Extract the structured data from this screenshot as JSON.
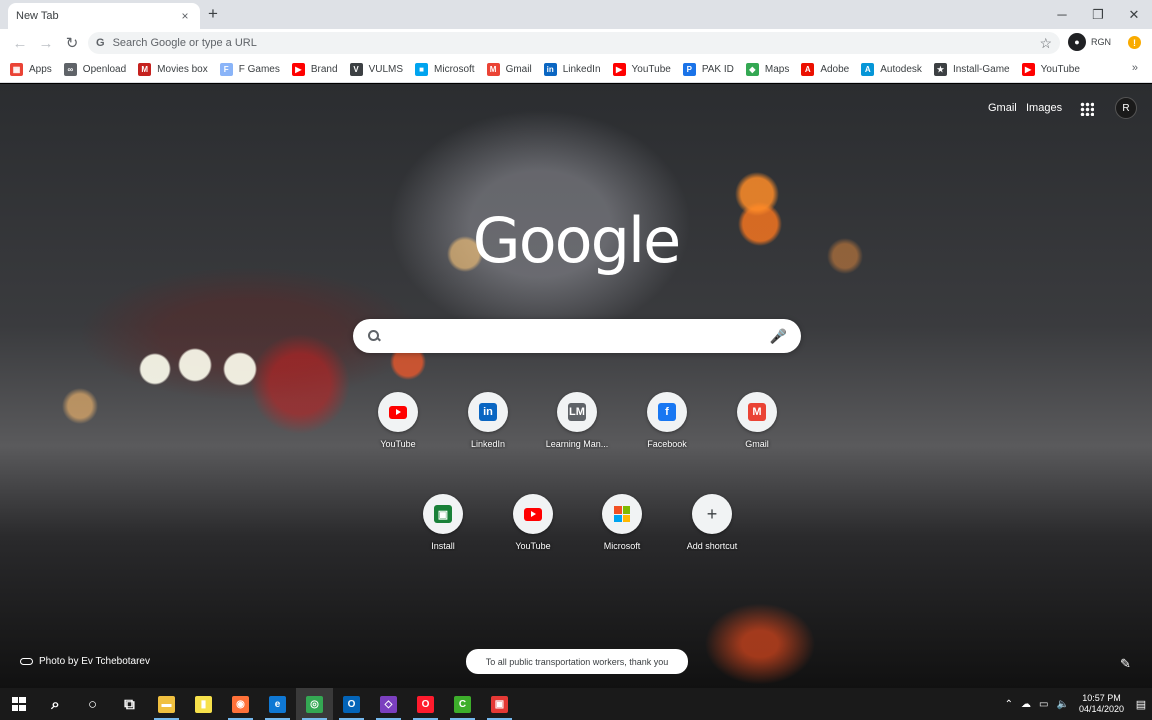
{
  "browser": {
    "tab_title": "New Tab",
    "tab_close": "×",
    "new_tab": "+",
    "window_controls": {
      "minimize": "─",
      "restore": "❐",
      "close": "✕"
    },
    "nav": {
      "back": "←",
      "forward": "→",
      "reload": "↻"
    },
    "omnibox_g": "G",
    "omnibox_placeholder": "Search Google or type a URL",
    "star": "☆",
    "profile_initial": "●",
    "profile_name": "RGN",
    "update_badge": "!"
  },
  "bookmarks": [
    {
      "label": "Apps",
      "color": "#ea4335",
      "glyph": "▦"
    },
    {
      "label": "Openload",
      "color": "#5f6368",
      "glyph": "∞"
    },
    {
      "label": "Movies box",
      "color": "#c5221f",
      "glyph": "M"
    },
    {
      "label": "F Games",
      "color": "#8ab4f8",
      "glyph": "F"
    },
    {
      "label": "Brand",
      "color": "#ff0000",
      "glyph": "▶"
    },
    {
      "label": "VULMS",
      "color": "#3c4043",
      "glyph": "V"
    },
    {
      "label": "Microsoft",
      "color": "#00a4ef",
      "glyph": "■"
    },
    {
      "label": "Gmail",
      "color": "#ea4335",
      "glyph": "M"
    },
    {
      "label": "LinkedIn",
      "color": "#0a66c2",
      "glyph": "in"
    },
    {
      "label": "YouTube",
      "color": "#ff0000",
      "glyph": "▶"
    },
    {
      "label": "PAK ID",
      "color": "#1a73e8",
      "glyph": "P"
    },
    {
      "label": "Maps",
      "color": "#34a853",
      "glyph": "◆"
    },
    {
      "label": "Adobe",
      "color": "#eb1000",
      "glyph": "A"
    },
    {
      "label": "Autodesk",
      "color": "#0696d7",
      "glyph": "A"
    },
    {
      "label": "Install-Game",
      "color": "#3c4043",
      "glyph": "★"
    },
    {
      "label": "YouTube",
      "color": "#ff0000",
      "glyph": "▶"
    }
  ],
  "bookmarks_more": "»",
  "ntp": {
    "gmail_link": "Gmail",
    "images_link": "Images",
    "account_initial": "R",
    "logo": "Google",
    "mic": "🎤",
    "photo_credit": "Photo by Ev Tchebotarev",
    "promo": "To all public transportation workers, thank you",
    "edit": "✎"
  },
  "shortcuts": [
    {
      "label": "YouTube",
      "type": "yt"
    },
    {
      "label": "LinkedIn",
      "type": "box",
      "glyph": "in",
      "color": "#0a66c2"
    },
    {
      "label": "Learning Man...",
      "type": "box",
      "glyph": "LM",
      "color": "#5f6368"
    },
    {
      "label": "Facebook",
      "type": "box",
      "glyph": "f",
      "color": "#1877f2"
    },
    {
      "label": "Gmail",
      "type": "box",
      "glyph": "M",
      "color": "#ea4335"
    },
    {
      "label": "Install",
      "type": "box",
      "glyph": "▣",
      "color": "#188038"
    },
    {
      "label": "YouTube",
      "type": "yt"
    },
    {
      "label": "Microsoft",
      "type": "ms"
    },
    {
      "label": "Add shortcut",
      "type": "add",
      "glyph": "+"
    }
  ],
  "taskbar": {
    "apps": [
      {
        "name": "start",
        "glyph": ""
      },
      {
        "name": "search",
        "glyph": "⌕",
        "color": "transparent"
      },
      {
        "name": "cortana",
        "glyph": "○",
        "color": "transparent"
      },
      {
        "name": "task-view",
        "glyph": "⧉",
        "color": "transparent"
      },
      {
        "name": "file-explorer",
        "glyph": "▬",
        "color": "#f0c040"
      },
      {
        "name": "sticky-notes",
        "glyph": "▮",
        "color": "#f7e14b"
      },
      {
        "name": "firefox",
        "glyph": "◉",
        "color": "#ff7139"
      },
      {
        "name": "edge",
        "glyph": "e",
        "color": "#0f78d4"
      },
      {
        "name": "chrome",
        "glyph": "◎",
        "color": "#34a853"
      },
      {
        "name": "outlook",
        "glyph": "O",
        "color": "#0364b8"
      },
      {
        "name": "visual-studio",
        "glyph": "◇",
        "color": "#7b3fbf"
      },
      {
        "name": "opera",
        "glyph": "O",
        "color": "#ff1b2d"
      },
      {
        "name": "camtasia",
        "glyph": "C",
        "color": "#3dae2b"
      },
      {
        "name": "recorder",
        "glyph": "▣",
        "color": "#e53935"
      }
    ],
    "tray_arrow": "⌃",
    "tray_cloud": "☁",
    "tray_network": "▭",
    "tray_volume": "🔈",
    "time": "10:57 PM",
    "date": "04/14/2020",
    "notifications": "▤"
  }
}
